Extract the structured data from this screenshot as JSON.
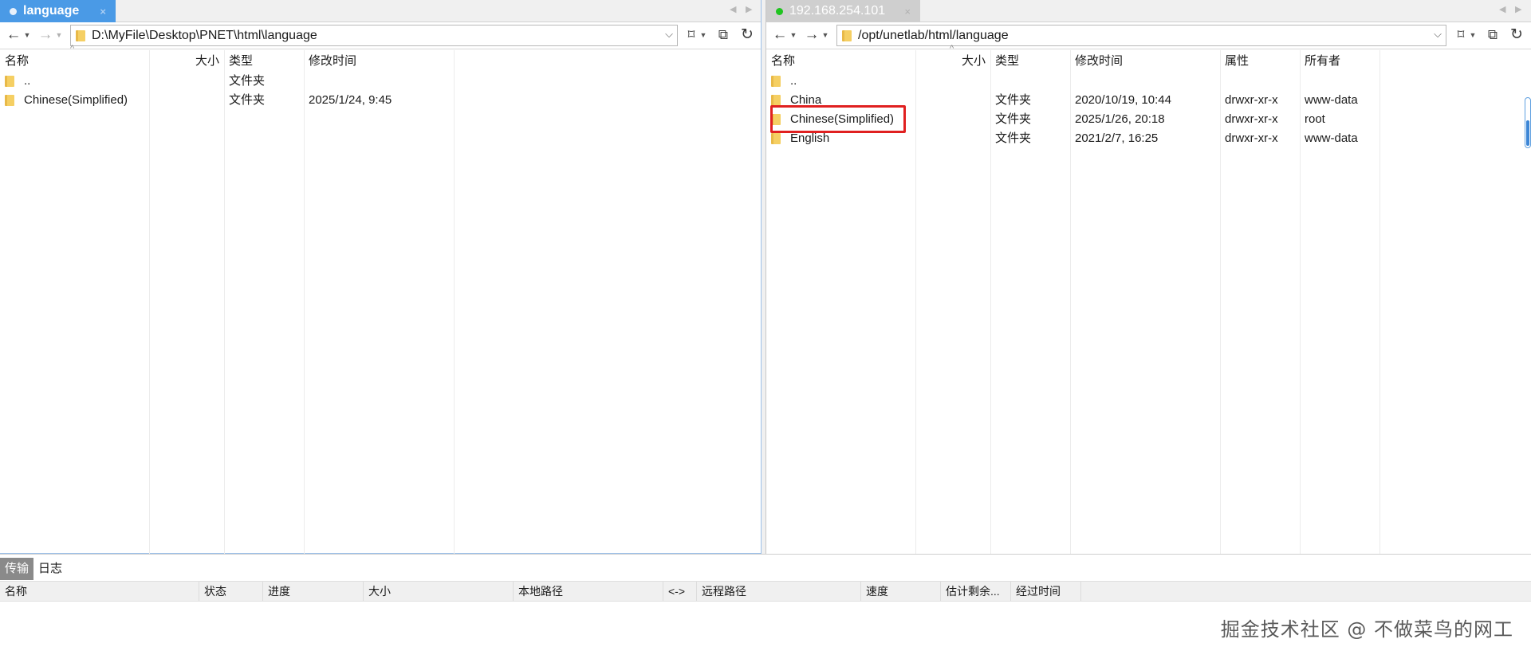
{
  "left": {
    "tab": {
      "label": "language",
      "close": "×"
    },
    "path": "D:\\MyFile\\Desktop\\PNET\\html\\language",
    "columns": {
      "name": "名称",
      "size": "大小",
      "type": "类型",
      "modified": "修改时间"
    },
    "rows": [
      {
        "name": "..",
        "type": "文件夹",
        "modified": ""
      },
      {
        "name": "Chinese(Simplified)",
        "type": "文件夹",
        "modified": "2025/1/24, 9:45"
      }
    ]
  },
  "right": {
    "tab": {
      "label": "192.168.254.101",
      "close": "×"
    },
    "path": "/opt/unetlab/html/language",
    "columns": {
      "name": "名称",
      "size": "大小",
      "type": "类型",
      "modified": "修改时间",
      "perms": "属性",
      "owner": "所有者"
    },
    "rows": [
      {
        "name": "..",
        "type": "",
        "modified": "",
        "perms": "",
        "owner": ""
      },
      {
        "name": "China",
        "type": "文件夹",
        "modified": "2020/10/19, 10:44",
        "perms": "drwxr-xr-x",
        "owner": "www-data"
      },
      {
        "name": "Chinese(Simplified)",
        "type": "文件夹",
        "modified": "2025/1/26, 20:18",
        "perms": "drwxr-xr-x",
        "owner": "root"
      },
      {
        "name": "English",
        "type": "文件夹",
        "modified": "2021/2/7, 16:25",
        "perms": "drwxr-xr-x",
        "owner": "www-data"
      }
    ]
  },
  "queue": {
    "tabs": [
      "传输",
      "日志"
    ],
    "columns": [
      "名称",
      "状态",
      "进度",
      "大小",
      "本地路径",
      "<->",
      "远程路径",
      "速度",
      "估计剩余...",
      "经过时间"
    ]
  },
  "watermark": "掘金技术社区 @ 不做菜鸟的网工",
  "colors": {
    "active_tab": "#4a9ae6",
    "connected_dot": "#1fc41f",
    "highlight": "#e02020"
  }
}
